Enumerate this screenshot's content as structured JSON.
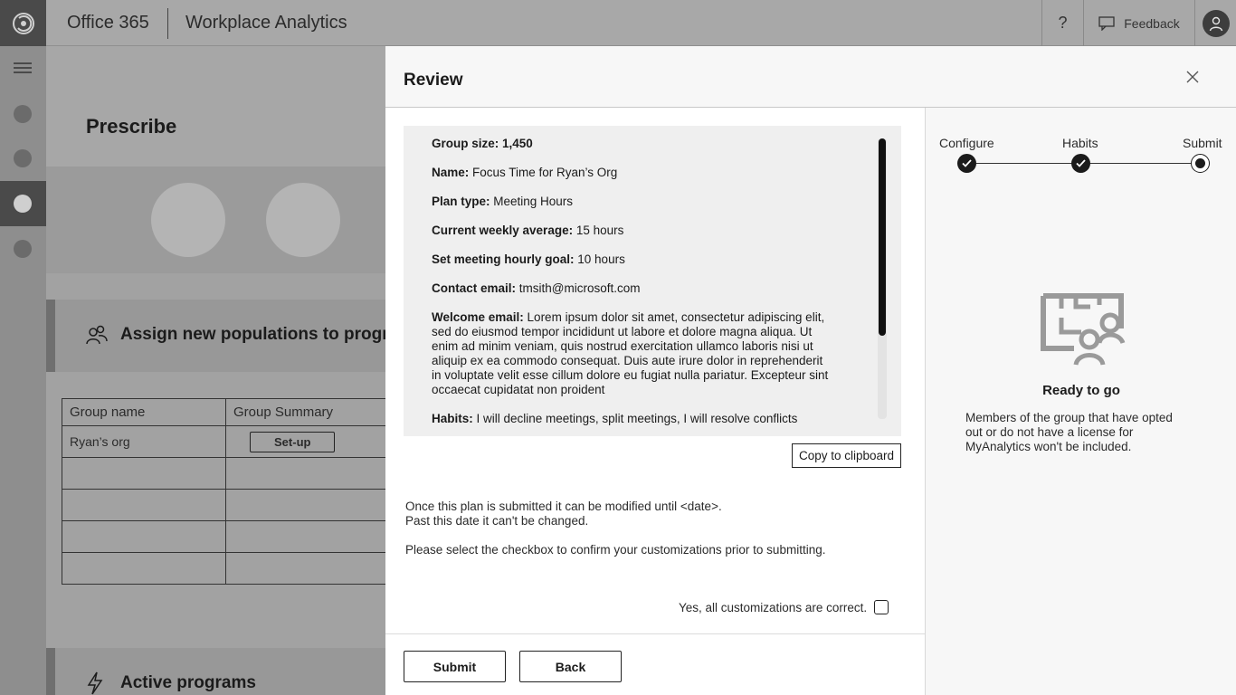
{
  "app": {
    "suite": "Office 365",
    "product": "Workplace Analytics",
    "help_label": "?",
    "feedback_label": "Feedback"
  },
  "background": {
    "page_title": "Prescribe",
    "section_assign": "Assign new populations to programs",
    "table": {
      "headers": [
        "Group name",
        "Group Summary"
      ],
      "rows": [
        {
          "name": "Ryan’s org",
          "action": "Set-up"
        }
      ]
    },
    "section_active": "Active programs"
  },
  "panel": {
    "title": "Review",
    "summary": [
      {
        "label": "Group size: 1,450",
        "value": ""
      },
      {
        "label": "Name:",
        "value": " Focus Time for Ryan’s Org"
      },
      {
        "label": "Plan type:",
        "value": " Meeting Hours"
      },
      {
        "label": "Current weekly average:",
        "value": " 15 hours"
      },
      {
        "label": "Set meeting hourly goal:",
        "value": " 10 hours"
      },
      {
        "label": "Contact email:",
        "value": " tmsith@microsoft.com"
      },
      {
        "label": "Welcome email:",
        "value": "  Lorem ipsum dolor sit amet, consectetur adipiscing elit, sed do eiusmod tempor incididunt ut labore et dolore magna aliqua. Ut enim ad minim veniam, quis nostrud exercitation ullamco laboris nisi ut aliquip ex ea commodo consequat. Duis aute irure dolor in reprehenderit in voluptate velit esse cillum dolore eu fugiat nulla pariatur. Excepteur sint occaecat cupidatat non proident"
      },
      {
        "label": "Habits:",
        "value": " I will decline meetings, split meetings, I will resolve conflicts"
      }
    ],
    "copy_label": "Copy to clipboard",
    "note_line1": "Once this plan is submitted it can be modified until <date>.",
    "note_line2": "Past this date it can't be changed.",
    "note_select": "Please select the checkbox to confirm your customizations prior to submitting.",
    "confirm_label": "Yes, all customizations are correct.",
    "submit_label": "Submit",
    "back_label": "Back"
  },
  "stepper": {
    "steps": [
      "Configure",
      "Habits",
      "Submit"
    ],
    "completed": 2
  },
  "ready": {
    "title": "Ready to go",
    "body": "Members of the group that have opted out or do not have a license for MyAnalytics won't be included."
  }
}
